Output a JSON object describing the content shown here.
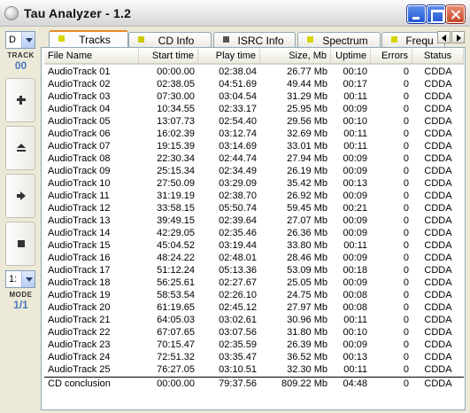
{
  "window": {
    "title": "Tau Analyzer - 1.2"
  },
  "sidebar": {
    "drive_combo": "D",
    "track_label": "TRACK",
    "track_value": "00",
    "mode_combo": "1:",
    "mode_label": "MODE",
    "mode_value": "1/1",
    "buttons": [
      "add-icon",
      "eject-icon",
      "play-icon",
      "stop-icon"
    ]
  },
  "tabs": [
    {
      "label": "Tracks",
      "icon_color": "#d7d400",
      "active": true
    },
    {
      "label": "CD Info",
      "icon_color": "#cbc800"
    },
    {
      "label": "ISRC Info",
      "icon_color": "#555555"
    },
    {
      "label": "Spectrum",
      "icon_color": "#d7d400"
    },
    {
      "label": "Frequ",
      "icon_color": "#d7d400"
    }
  ],
  "table": {
    "columns": [
      "File Name",
      "Start time",
      "Play time",
      "Size, Mb",
      "Uptime",
      "Errors",
      "Status"
    ],
    "rows": [
      [
        "AudioTrack 01",
        "00:00.00",
        "02:38.04",
        "26.77 Mb",
        "00:10",
        "0",
        "CDDA"
      ],
      [
        "AudioTrack 02",
        "02:38.05",
        "04:51.69",
        "49.44 Mb",
        "00:17",
        "0",
        "CDDA"
      ],
      [
        "AudioTrack 03",
        "07:30.00",
        "03:04.54",
        "31.29 Mb",
        "00:11",
        "0",
        "CDDA"
      ],
      [
        "AudioTrack 04",
        "10:34.55",
        "02:33.17",
        "25.95 Mb",
        "00:09",
        "0",
        "CDDA"
      ],
      [
        "AudioTrack 05",
        "13:07.73",
        "02:54.40",
        "29.56 Mb",
        "00:10",
        "0",
        "CDDA"
      ],
      [
        "AudioTrack 06",
        "16:02.39",
        "03:12.74",
        "32.69 Mb",
        "00:11",
        "0",
        "CDDA"
      ],
      [
        "AudioTrack 07",
        "19:15.39",
        "03:14.69",
        "33.01 Mb",
        "00:11",
        "0",
        "CDDA"
      ],
      [
        "AudioTrack 08",
        "22:30.34",
        "02:44.74",
        "27.94 Mb",
        "00:09",
        "0",
        "CDDA"
      ],
      [
        "AudioTrack 09",
        "25:15.34",
        "02:34.49",
        "26.19 Mb",
        "00:09",
        "0",
        "CDDA"
      ],
      [
        "AudioTrack 10",
        "27:50.09",
        "03:29.09",
        "35.42 Mb",
        "00:13",
        "0",
        "CDDA"
      ],
      [
        "AudioTrack 11",
        "31:19.19",
        "02:38.70",
        "26.92 Mb",
        "00:09",
        "0",
        "CDDA"
      ],
      [
        "AudioTrack 12",
        "33:58.15",
        "05:50.74",
        "59.45 Mb",
        "00:21",
        "0",
        "CDDA"
      ],
      [
        "AudioTrack 13",
        "39:49.15",
        "02:39.64",
        "27.07 Mb",
        "00:09",
        "0",
        "CDDA"
      ],
      [
        "AudioTrack 14",
        "42:29.05",
        "02:35.46",
        "26.36 Mb",
        "00:09",
        "0",
        "CDDA"
      ],
      [
        "AudioTrack 15",
        "45:04.52",
        "03:19.44",
        "33.80 Mb",
        "00:11",
        "0",
        "CDDA"
      ],
      [
        "AudioTrack 16",
        "48:24.22",
        "02:48.01",
        "28.46 Mb",
        "00:09",
        "0",
        "CDDA"
      ],
      [
        "AudioTrack 17",
        "51:12.24",
        "05:13.36",
        "53.09 Mb",
        "00:18",
        "0",
        "CDDA"
      ],
      [
        "AudioTrack 18",
        "56:25.61",
        "02:27.67",
        "25.05 Mb",
        "00:09",
        "0",
        "CDDA"
      ],
      [
        "AudioTrack 19",
        "58:53.54",
        "02:26.10",
        "24.75 Mb",
        "00:08",
        "0",
        "CDDA"
      ],
      [
        "AudioTrack 20",
        "61:19.65",
        "02:45.12",
        "27.97 Mb",
        "00:08",
        "0",
        "CDDA"
      ],
      [
        "AudioTrack 21",
        "64:05.03",
        "03:02.61",
        "30.96 Mb",
        "00:11",
        "0",
        "CDDA"
      ],
      [
        "AudioTrack 22",
        "67:07.65",
        "03:07.56",
        "31.80 Mb",
        "00:10",
        "0",
        "CDDA"
      ],
      [
        "AudioTrack 23",
        "70:15.47",
        "02:35.59",
        "26.39 Mb",
        "00:09",
        "0",
        "CDDA"
      ],
      [
        "AudioTrack 24",
        "72:51.32",
        "03:35.47",
        "36.52 Mb",
        "00:13",
        "0",
        "CDDA"
      ],
      [
        "AudioTrack 25",
        "76:27.05",
        "03:10.51",
        "32.30 Mb",
        "00:11",
        "0",
        "CDDA"
      ]
    ],
    "total": [
      "CD conclusion",
      "00:00.00",
      "79:37.56",
      "809.22 Mb",
      "04:48",
      "0",
      "CDDA"
    ]
  }
}
